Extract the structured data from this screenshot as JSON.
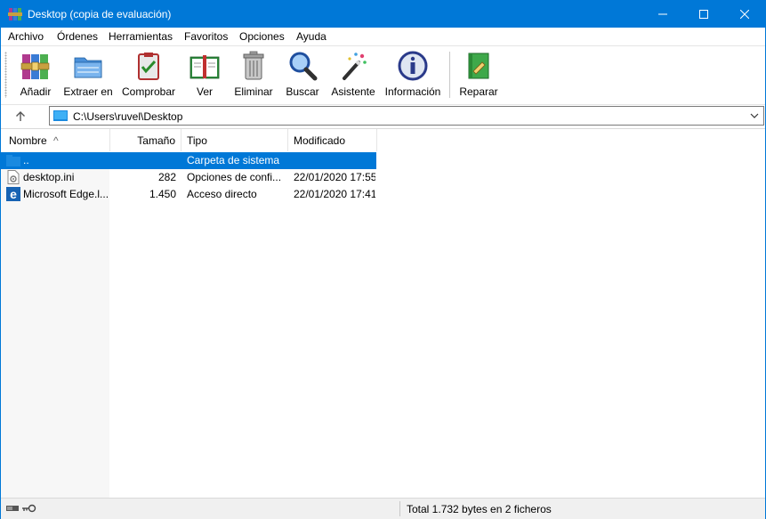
{
  "window": {
    "title": "Desktop (copia de evaluación)"
  },
  "menu": [
    "Archivo",
    "Órdenes",
    "Herramientas",
    "Favoritos",
    "Opciones",
    "Ayuda"
  ],
  "toolbar": {
    "add": "Añadir",
    "extract": "Extraer en",
    "test": "Comprobar",
    "view": "Ver",
    "delete": "Eliminar",
    "find": "Buscar",
    "wizard": "Asistente",
    "info": "Información",
    "repair": "Reparar"
  },
  "address": {
    "path": "C:\\Users\\ruvel\\Desktop"
  },
  "columns": {
    "name": "Nombre",
    "size": "Tamaño",
    "type": "Tipo",
    "modified": "Modificado"
  },
  "rows": [
    {
      "name": "..",
      "size": "",
      "type": "Carpeta de sistema",
      "modified": "",
      "icon": "folder-icon",
      "selected": true
    },
    {
      "name": "desktop.ini",
      "size": "282",
      "type": "Opciones de confi...",
      "modified": "22/01/2020 17:55",
      "icon": "settings-file-icon",
      "selected": false
    },
    {
      "name": "Microsoft Edge.l...",
      "size": "1.450",
      "type": "Acceso directo",
      "modified": "22/01/2020 17:41",
      "icon": "edge-icon",
      "selected": false
    }
  ],
  "status": {
    "text": "Total 1.732 bytes en 2 ficheros"
  },
  "colors": {
    "accent": "#0078d7",
    "titlebar_text": "#ffffff"
  }
}
